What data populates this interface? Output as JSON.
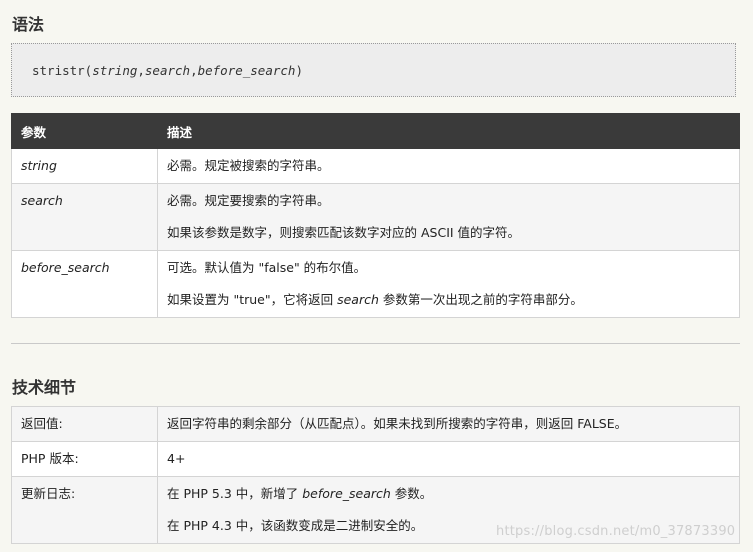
{
  "syntax_heading": "语法",
  "syntax_code": {
    "fn": "stristr(",
    "p1": "string",
    "c1": ",",
    "p2": "search",
    "c2": ",",
    "p3": "before_search",
    "close": ")"
  },
  "params_table": {
    "headers": [
      "参数",
      "描述"
    ],
    "rows": [
      {
        "name": "string",
        "desc": [
          "必需。规定被搜索的字符串。"
        ]
      },
      {
        "name": "search",
        "desc": [
          "必需。规定要搜索的字符串。",
          "如果该参数是数字，则搜索匹配该数字对应的 ASCII 值的字符。"
        ]
      },
      {
        "name": "before_search",
        "desc1": "可选。默认值为 \"false\" 的布尔值。",
        "desc2_pre": "如果设置为 \"true\"，它将返回 ",
        "desc2_it": "search",
        "desc2_post": " 参数第一次出现之前的字符串部分。"
      }
    ]
  },
  "tech_heading": "技术细节",
  "tech_table": {
    "rows": [
      {
        "label": "返回值:",
        "value": "返回字符串的剩余部分（从匹配点）。如果未找到所搜索的字符串，则返回 FALSE。"
      },
      {
        "label": "PHP 版本:",
        "value": "4+"
      },
      {
        "label": "更新日志:",
        "v1_pre": "在 PHP 5.3 中，新增了 ",
        "v1_it": "before_search",
        "v1_post": " 参数。",
        "v2": "在 PHP 4.3 中，该函数变成是二进制安全的。"
      }
    ]
  },
  "watermark": "https://blog.csdn.net/m0_37873390"
}
